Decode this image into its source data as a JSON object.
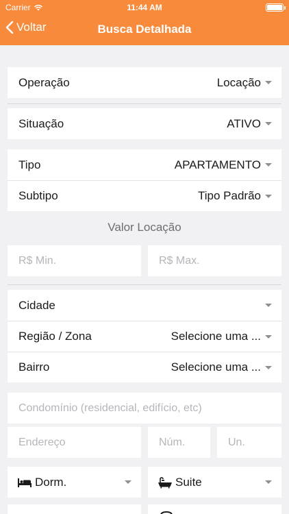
{
  "status": {
    "carrier": "Carrier",
    "time": "11:44 AM"
  },
  "nav": {
    "back_label": "Voltar",
    "title": "Busca Detalhada"
  },
  "operacao": {
    "label": "Operação",
    "value": "Locação"
  },
  "situacao": {
    "label": "Situação",
    "value": "ATIVO"
  },
  "tipo": {
    "label": "Tipo",
    "value": "APARTAMENTO"
  },
  "subtipo": {
    "label": "Subtipo",
    "value": "Tipo Padrão"
  },
  "valor": {
    "title": "Valor Locação",
    "min_placeholder": "R$ Min.",
    "max_placeholder": "R$ Max."
  },
  "cidade": {
    "label": "Cidade",
    "value": ""
  },
  "regiao": {
    "label": "Região / Zona",
    "value": "Selecione uma ..."
  },
  "bairro": {
    "label": "Bairro",
    "value": "Selecione uma ..."
  },
  "condominio": {
    "placeholder": "Condomínio (residencial, edifício, etc)"
  },
  "endereco": {
    "placeholder": "Endereço",
    "num_placeholder": "Núm.",
    "un_placeholder": "Un."
  },
  "dorm": {
    "label": "Dorm.",
    "icon": "bed-icon"
  },
  "suite": {
    "label": "Suite",
    "icon": "bathtub-icon"
  },
  "colors": {
    "header": "#f78a3b",
    "background": "#f1f1f3"
  }
}
